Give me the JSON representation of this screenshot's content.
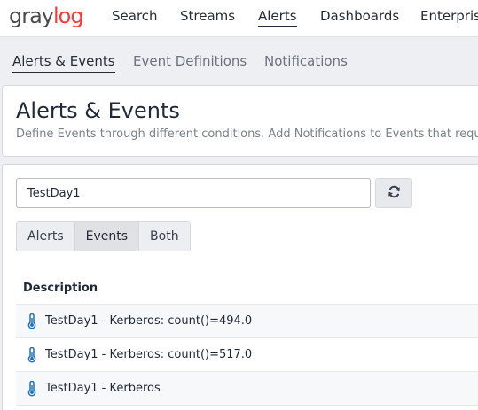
{
  "brand": {
    "logo_left": "gray",
    "logo_right": "log"
  },
  "topnav": {
    "items": [
      {
        "label": "Search"
      },
      {
        "label": "Streams"
      },
      {
        "label": "Alerts",
        "active": true
      },
      {
        "label": "Dashboards"
      },
      {
        "label": "Enterprise"
      }
    ]
  },
  "subnav": {
    "items": [
      {
        "label": "Alerts & Events",
        "active": true
      },
      {
        "label": "Event Definitions"
      },
      {
        "label": "Notifications"
      }
    ]
  },
  "header": {
    "title": "Alerts & Events",
    "description": "Define Events through different conditions. Add Notifications to Events that require"
  },
  "search": {
    "value": "TestDay1"
  },
  "filters": {
    "options": [
      "Alerts",
      "Events",
      "Both"
    ],
    "selected": "Events"
  },
  "table": {
    "header": "Description",
    "rows": [
      {
        "icon": "thermometer-icon",
        "text": "TestDay1 - Kerberos: count()=494.0"
      },
      {
        "icon": "thermometer-icon",
        "text": "TestDay1 - Kerberos: count()=517.0"
      },
      {
        "icon": "thermometer-icon",
        "text": "TestDay1 - Kerberos"
      }
    ]
  },
  "colors": {
    "logo_red": "#ff3633",
    "icon_blue": "#1f6fb3"
  }
}
